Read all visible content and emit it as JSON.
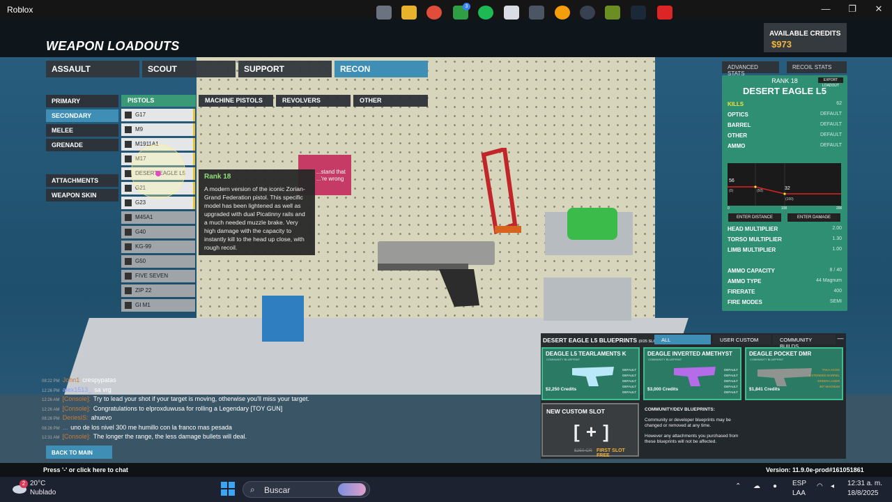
{
  "window": {
    "title": "Roblox",
    "controls": [
      "—",
      "❐",
      "✕"
    ]
  },
  "header": {
    "title": "WEAPON LOADOUTS",
    "credits_label": "AVAILABLE CREDITS",
    "credits_value": "$973"
  },
  "class_tabs": [
    "ASSAULT",
    "SCOUT",
    "SUPPORT",
    "RECON"
  ],
  "slot_buttons": [
    "PRIMARY",
    "SECONDARY",
    "MELEE",
    "GRENADE"
  ],
  "extra_buttons": [
    "ATTACHMENTS",
    "WEAPON SKIN"
  ],
  "sub_tabs": [
    "PISTOLS",
    "MACHINE PISTOLS",
    "REVOLVERS",
    "OTHER"
  ],
  "weapons": [
    "G17",
    "M9",
    "M1911A1",
    "M17",
    "DESERT EAGLE L5",
    "G21",
    "G23",
    "M45A1",
    "G40",
    "KG-99",
    "G50",
    "FIVE SEVEN",
    "ZIP 22",
    "GI M1"
  ],
  "tooltip": {
    "rank": "Rank 18",
    "desc": "A modern version of the iconic Zorian-Grand Federation pistol. This specific model has been lightened as well as upgraded with dual Picatinny rails and a much needed muzzle brake. Very high damage with the capacity to instantly kill to the head up close, with rough recoil."
  },
  "scene": {
    "poster": "...stand that ...'re wrong"
  },
  "stats_tabs": [
    "ADVANCED STATS",
    "RECOIL STATS"
  ],
  "stats": {
    "rank": "RANK 18",
    "name": "DESERT EAGLE L5",
    "export": "EXPORT LOADOUT",
    "rows": [
      {
        "k": "KILLS",
        "v": "62"
      },
      {
        "k": "OPTICS",
        "v": "DEFAULT"
      },
      {
        "k": "BARREL",
        "v": "DEFAULT"
      },
      {
        "k": "OTHER",
        "v": "DEFAULT"
      },
      {
        "k": "AMMO",
        "v": "DEFAULT"
      }
    ],
    "graph": {
      "start": "56",
      "end": "32",
      "d1": "(50)",
      "d2": "(100)",
      "d0": "(0)",
      "x0": "0",
      "x1": "100",
      "x2": "200"
    },
    "btns": [
      "ENTER DISTANCE",
      "ENTER DAMAGE"
    ],
    "mults": [
      {
        "k": "HEAD MULTIPLIER",
        "v": "2.00"
      },
      {
        "k": "TORSO MULTIPLIER",
        "v": "1.30"
      },
      {
        "k": "LIMB MULTIPLIER",
        "v": "1.00"
      }
    ],
    "ammo": [
      {
        "k": "AMMO CAPACITY",
        "v": "8 / 40"
      },
      {
        "k": "AMMO TYPE",
        "v": "44 Magnum"
      },
      {
        "k": "FIRERATE",
        "v": "400"
      },
      {
        "k": "FIRE MODES",
        "v": "SEMI"
      }
    ]
  },
  "chat": [
    {
      "t": "08:22 PM",
      "u": "John1",
      "m": "crespypatas"
    },
    {
      "t": "12:26 PM",
      "u": "alex1513_",
      "m": "sa vrg"
    },
    {
      "t": "12:26 AM",
      "u": "[Console]:",
      "m": "Try to lead your shot if your target is moving, otherwise you'll miss your target."
    },
    {
      "t": "12:26 AM",
      "u": "[Console]:",
      "m": "Congratulations to elproxduwusa for rolling a Legendary [TOY GUN]"
    },
    {
      "t": "08:26 PM",
      "u": "DeriesIS:",
      "m": "ahuevo"
    },
    {
      "t": "08:26 PM",
      "u": "...",
      "m": "uno de los nivel 300 me humillo con la franco mas pesada"
    },
    {
      "t": "12:31 AM",
      "u": "[Console]:",
      "m": "The longer the range, the less damage bullets will deal."
    }
  ],
  "back_label": "BACK TO MAIN",
  "chat_hint": "Press '-' or click here to chat",
  "version": "Version: 11.9.0e-prod#161051861",
  "blueprints": {
    "title": "DESERT EAGLE L5 BLUEPRINTS",
    "count": "(0/25 SLO",
    "tabs": [
      "ALL",
      "USER CUSTOM",
      "COMMUNITY BUILDS"
    ],
    "min": "—",
    "cards": [
      {
        "name": "DEAGLE L5 TEARLAMENTS K",
        "sub": "COMMUNITY BLUEPRINT",
        "price": "$2,250 Credits",
        "d": [
          "DEFAULT",
          "DEFAULT",
          "DEFAULT",
          "DEFAULT",
          "DEFAULT"
        ]
      },
      {
        "name": "DEAGLE INVERTED AMETHYST",
        "sub": "COMMUNITY BLUEPRINT",
        "price": "$3,000 Credits",
        "d": [
          "DEFAULT",
          "DEFAULT",
          "DEFAULT",
          "DEFAULT",
          "DEFAULT"
        ]
      },
      {
        "name": "DEAGLE POCKET DMR",
        "sub": "COMMUNITY BLUEPRINT",
        "price": "$1,841 Credits",
        "d": [
          "TAKA ACOG",
          "EXTENDED BARREL",
          "GREEN LASER",
          "357 MAGNUM"
        ]
      }
    ],
    "new_slot": "NEW CUSTOM SLOT",
    "plus": "[ + ]",
    "old_price": "$250 CR",
    "free": "FIRST SLOT FREE",
    "note_title": "COMMUNITY/DEV BLUEPRINTS:",
    "note1": "Community or developer blueprints may be changed or removed at any time.",
    "note2": "However any attachments you purchased from these blueprints will not be affected."
  },
  "taskbar": {
    "temp": "20°C",
    "weather": "Nublado",
    "badge": "2",
    "search": "Buscar",
    "lang1": "ESP",
    "lang2": "LAA",
    "time": "12:31 a. m.",
    "date": "18/8/2025",
    "xbox_badge": "3"
  }
}
